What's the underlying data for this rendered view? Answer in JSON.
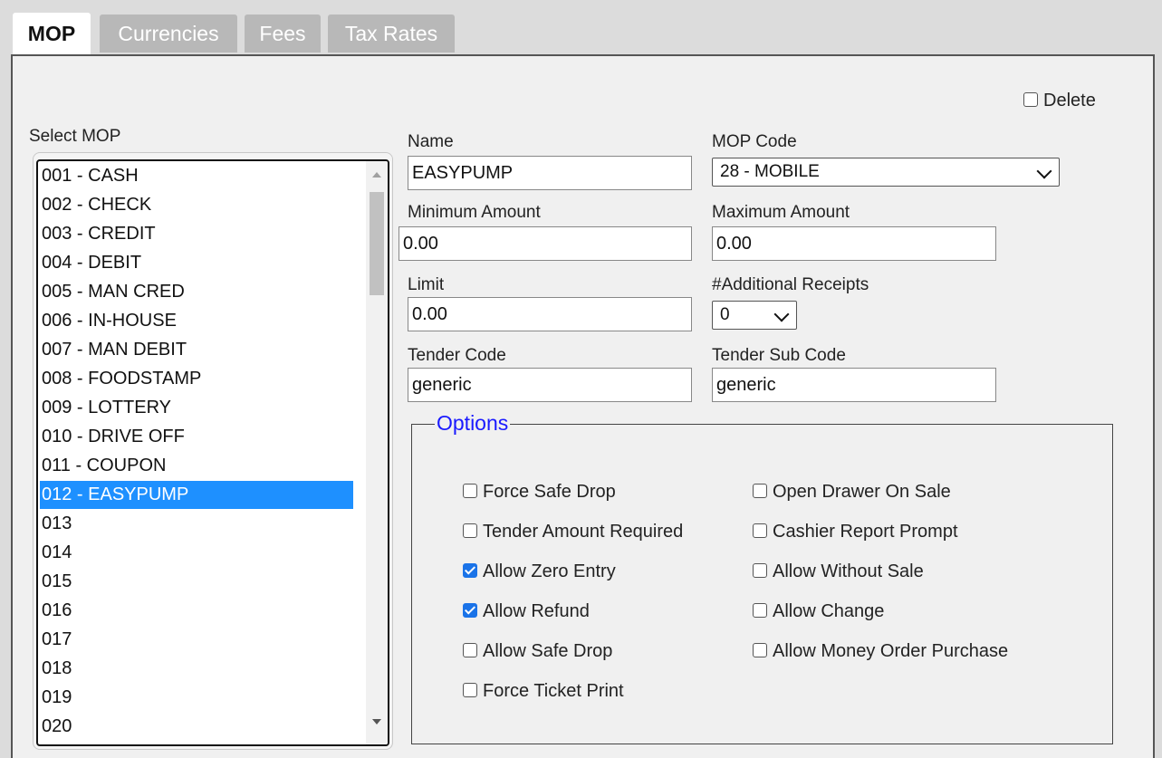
{
  "tabs": [
    {
      "label": "MOP",
      "active": true
    },
    {
      "label": "Currencies",
      "active": false
    },
    {
      "label": "Fees",
      "active": false
    },
    {
      "label": "Tax Rates",
      "active": false
    }
  ],
  "delete_label": "Delete",
  "select_mop_label": "Select MOP",
  "mop_list": [
    "001 - CASH",
    "002 - CHECK",
    "003 - CREDIT",
    "004 - DEBIT",
    "005 - MAN CRED",
    "006 - IN-HOUSE",
    "007 - MAN DEBIT",
    "008 - FOODSTAMP",
    "009 - LOTTERY",
    "010 - DRIVE OFF",
    "011 - COUPON",
    "012 - EASYPUMP",
    "013",
    "014",
    "015",
    "016",
    "017",
    "018",
    "019",
    "020"
  ],
  "selected_mop": "012 - EASYPUMP",
  "form": {
    "name_label": "Name",
    "name_value": "EASYPUMP",
    "mop_code_label": "MOP Code",
    "mop_code_value": "28 - MOBILE",
    "min_amount_label": "Minimum Amount",
    "min_amount_value": "0.00",
    "max_amount_label": "Maximum Amount",
    "max_amount_value": "0.00",
    "limit_label": "Limit",
    "limit_value": "0.00",
    "additional_receipts_label": "#Additional Receipts",
    "additional_receipts_value": "0",
    "tender_code_label": "Tender Code",
    "tender_code_value": "generic",
    "tender_sub_code_label": "Tender Sub Code",
    "tender_sub_code_value": "generic"
  },
  "options": {
    "legend": "Options",
    "left": [
      {
        "label": "Force Safe Drop",
        "checked": false
      },
      {
        "label": "Tender Amount Required",
        "checked": false
      },
      {
        "label": "Allow Zero Entry",
        "checked": true
      },
      {
        "label": "Allow Refund",
        "checked": true
      },
      {
        "label": "Allow Safe Drop",
        "checked": false
      },
      {
        "label": "Force Ticket Print",
        "checked": false
      }
    ],
    "right": [
      {
        "label": "Open Drawer On Sale",
        "checked": false
      },
      {
        "label": "Cashier Report Prompt",
        "checked": false
      },
      {
        "label": "Allow Without Sale",
        "checked": false
      },
      {
        "label": "Allow Change",
        "checked": false
      },
      {
        "label": "Allow Money Order Purchase",
        "checked": false
      }
    ]
  },
  "colors": {
    "selected_row": "#1e90ff",
    "legend": "#1a1aff",
    "checkbox_checked": "#1a73e8"
  }
}
